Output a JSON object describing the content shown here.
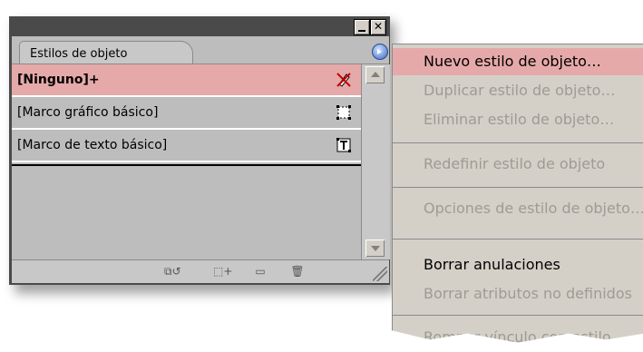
{
  "panel": {
    "tab_label": "Estilos de objeto",
    "window_buttons": [
      "minimize",
      "close"
    ],
    "styles": [
      {
        "label": "[Ninguno]+",
        "selected": true,
        "icon": "no-frame-icon"
      },
      {
        "label": "[Marco gráfico básico]",
        "selected": false,
        "icon": "graphic-frame-icon"
      },
      {
        "label": "[Marco de texto básico]",
        "selected": false,
        "icon": "text-frame-icon"
      }
    ],
    "bottom_icons": [
      "clear-overrides-icon",
      "new-style-icon",
      "page-icon",
      "trash-icon"
    ]
  },
  "menu": {
    "items": [
      {
        "label": "Nuevo estilo de objeto…",
        "state": "highlighted"
      },
      {
        "label": "Duplicar estilo de objeto…",
        "state": "disabled"
      },
      {
        "label": "Eliminar estilo de objeto…",
        "state": "disabled"
      },
      {
        "label": "Redefinir estilo de objeto",
        "state": "disabled"
      },
      {
        "label": "Opciones de estilo de objeto…",
        "state": "disabled"
      },
      {
        "label": "Borrar anulaciones",
        "state": "enabled"
      },
      {
        "label": "Borrar atributos no definidos",
        "state": "disabled"
      },
      {
        "label": "Romper vínculo con estilo",
        "state": "disabled"
      }
    ]
  },
  "colors": {
    "selection": "#e6a9a9",
    "panel_bg": "#bdbdbd",
    "menu_bg": "#d4d0c8",
    "disabled_text": "#9e9b95"
  }
}
